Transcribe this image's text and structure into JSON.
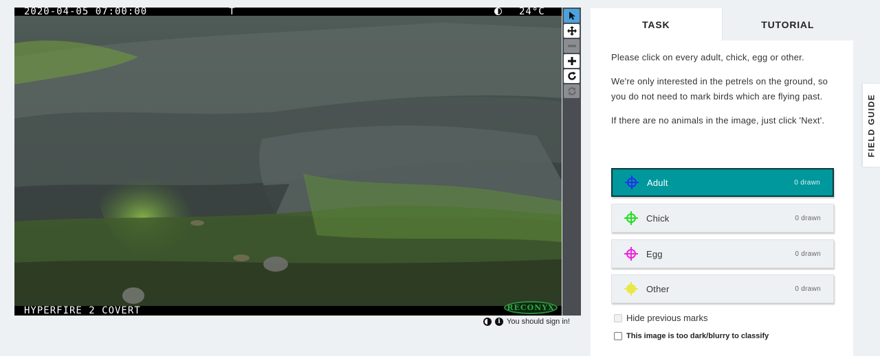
{
  "viewer": {
    "camera_stamp": {
      "timestamp": "2020-04-05 07:00:00",
      "flag": "T",
      "temperature": "24°C",
      "model": "HYPERFIRE 2 COVERT",
      "brand": "RECONYX"
    },
    "toolbar": {
      "tools": [
        {
          "icon": "pointer-icon",
          "state": "active"
        },
        {
          "icon": "move-icon",
          "state": "normal"
        },
        {
          "icon": "zoom-out-icon",
          "state": "disabled"
        },
        {
          "icon": "zoom-in-icon",
          "state": "normal"
        },
        {
          "icon": "rotate-icon",
          "state": "normal"
        },
        {
          "icon": "reset-icon",
          "state": "disabled"
        }
      ]
    },
    "sign_in_notice": "You should sign in!"
  },
  "task_panel": {
    "tabs": [
      {
        "label": "TASK",
        "active": true
      },
      {
        "label": "TUTORIAL",
        "active": false
      }
    ],
    "instructions": [
      "Please click on every adult, chick, egg or other.",
      "We're only interested in the petrels on the ground, so you do not need to mark birds which are flying past.",
      "If there are no animals in the image, just click 'Next'."
    ],
    "tools": [
      {
        "label": "Adult",
        "count": "0 drawn",
        "color": "#2233ee",
        "selected": true
      },
      {
        "label": "Chick",
        "count": "0 drawn",
        "color": "#22dd22",
        "selected": false
      },
      {
        "label": "Egg",
        "count": "0 drawn",
        "color": "#ee22dd",
        "selected": false
      },
      {
        "label": "Other",
        "count": "0 drawn",
        "color": "#e8e84a",
        "selected": false
      }
    ],
    "hide_marks_label": "Hide previous marks",
    "too_dark_label": "This image is too dark/blurry to classify"
  },
  "field_guide": {
    "label": "FIELD GUIDE"
  },
  "colors": {
    "accent": "#00979d",
    "tool_active": "#4aa3df"
  }
}
